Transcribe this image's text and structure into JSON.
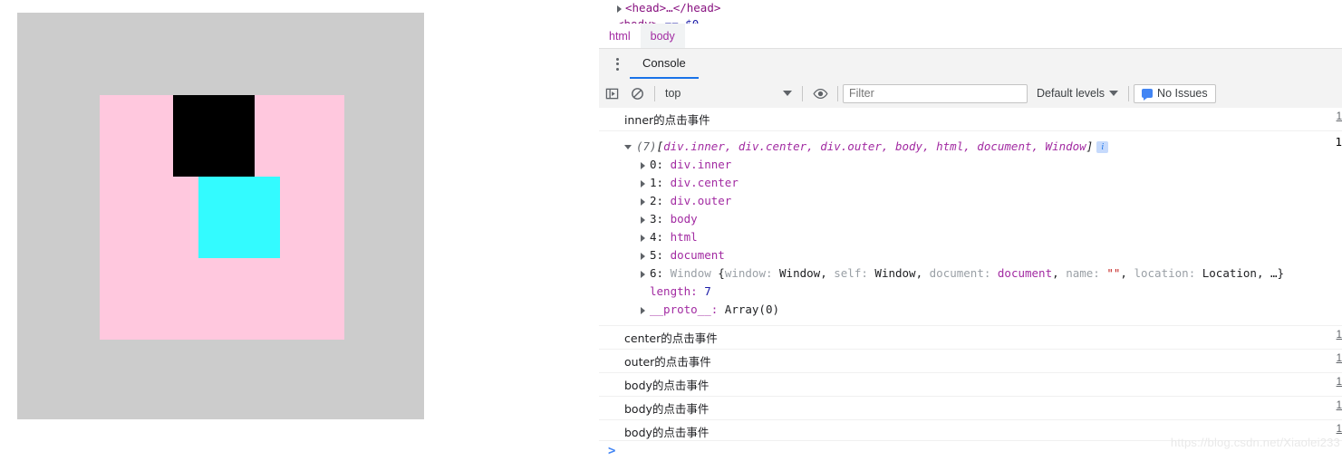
{
  "demo": {
    "panel_name": "demo-stage",
    "colors": {
      "stage_bg": "#cccccc",
      "outer": "#ffc8de",
      "center": "#000000",
      "inner": "#33fbff"
    },
    "boxes": [
      {
        "name": "outer",
        "color": "#ffc8de"
      },
      {
        "name": "center",
        "color": "#000000"
      },
      {
        "name": "inner",
        "color": "#33fbff"
      }
    ]
  },
  "devtools": {
    "dom_tree": {
      "line1_open": "<head>",
      "line1_dots": "…",
      "line1_close": "</head>"
    },
    "breadcrumb": [
      {
        "label": "html",
        "selected": false
      },
      {
        "label": "body",
        "selected": true
      }
    ],
    "drawer": {
      "kebab_icon": "more-vertical-icon",
      "tabs": [
        {
          "label": "Console",
          "active": true
        }
      ]
    },
    "toolbar": {
      "sidebar_toggle_icon": "console-sidebar-icon",
      "clear_icon": "clear-console-icon",
      "context": "top",
      "context_caret_icon": "chevron-down-icon",
      "eye_icon": "eye-icon",
      "filter_placeholder": "Filter",
      "filter_value": "",
      "levels_label": "Default levels",
      "levels_caret_icon": "chevron-down-icon",
      "issues_label": "No Issues",
      "issues_icon": "issue-flag-icon"
    },
    "messages": [
      {
        "type": "log",
        "text": "inner的点击事件",
        "source": "1"
      },
      {
        "type": "object",
        "source": "1"
      },
      {
        "type": "log",
        "text": "center的点击事件",
        "source": "1"
      },
      {
        "type": "log",
        "text": "outer的点击事件",
        "source": "1"
      },
      {
        "type": "log",
        "text": "body的点击事件",
        "source": "1"
      },
      {
        "type": "log",
        "text": "body的点击事件",
        "source": "1"
      },
      {
        "type": "log",
        "text": "body的点击事件",
        "source": "1"
      }
    ],
    "array_object": {
      "count": "(7)",
      "preview_open": "[",
      "preview_items": "div.inner, div.center, div.outer, body, html, document, Window",
      "preview_close": "]",
      "info_badge": "i",
      "entries": [
        {
          "index": "0:",
          "value": "div.inner"
        },
        {
          "index": "1:",
          "value": "div.center"
        },
        {
          "index": "2:",
          "value": "div.outer"
        },
        {
          "index": "3:",
          "value": "body"
        },
        {
          "index": "4:",
          "value": "html"
        },
        {
          "index": "5:",
          "value": "document"
        }
      ],
      "window_entry": {
        "index": "6:",
        "ctor": "Window",
        "open": "{",
        "k1": "window:",
        "v1": "Window",
        "k2": "self:",
        "v2": "Window",
        "k3": "document:",
        "v3": "document",
        "k4": "name:",
        "v4": "\"\"",
        "k5": "location:",
        "v5": "Location",
        "tail": ", …}"
      },
      "length_key": "length:",
      "length_value": "7",
      "proto_key": "__proto__:",
      "proto_value": "Array(0)"
    },
    "prompt": {
      "chevron": ">"
    }
  },
  "watermark": {
    "text": "https://blog.csdn.net/Xiaolei233"
  }
}
